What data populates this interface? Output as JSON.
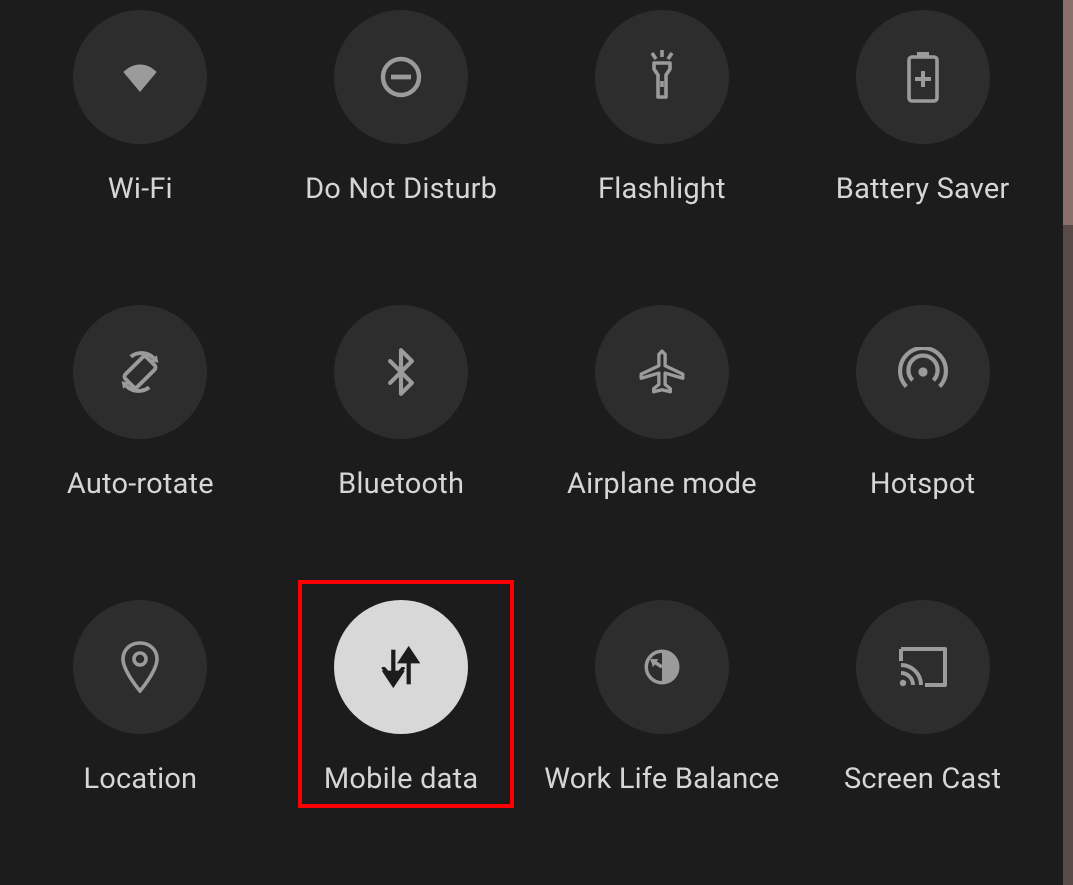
{
  "quick_settings": {
    "tiles": [
      {
        "id": "wifi",
        "label": "Wi-Fi",
        "active": false,
        "highlighted": false
      },
      {
        "id": "dnd",
        "label": "Do Not Disturb",
        "active": false,
        "highlighted": false
      },
      {
        "id": "flashlight",
        "label": "Flashlight",
        "active": false,
        "highlighted": false
      },
      {
        "id": "battery-saver",
        "label": "Battery Saver",
        "active": false,
        "highlighted": false
      },
      {
        "id": "auto-rotate",
        "label": "Auto-rotate",
        "active": false,
        "highlighted": false
      },
      {
        "id": "bluetooth",
        "label": "Bluetooth",
        "active": false,
        "highlighted": false
      },
      {
        "id": "airplane",
        "label": "Airplane mode",
        "active": false,
        "highlighted": false
      },
      {
        "id": "hotspot",
        "label": "Hotspot",
        "active": false,
        "highlighted": false
      },
      {
        "id": "location",
        "label": "Location",
        "active": false,
        "highlighted": false
      },
      {
        "id": "mobile-data",
        "label": "Mobile data",
        "active": true,
        "highlighted": true
      },
      {
        "id": "work-life",
        "label": "Work Life Balance",
        "active": false,
        "highlighted": false
      },
      {
        "id": "screen-cast",
        "label": "Screen Cast",
        "active": false,
        "highlighted": false
      }
    ]
  },
  "colors": {
    "background": "#1c1c1c",
    "tile_off_bg": "#2d2d2d",
    "tile_on_bg": "#d8d8d8",
    "icon_off": "#9b9b9b",
    "icon_on": "#1c1c1c",
    "label": "#d6d6d6",
    "highlight": "#ff0000"
  }
}
